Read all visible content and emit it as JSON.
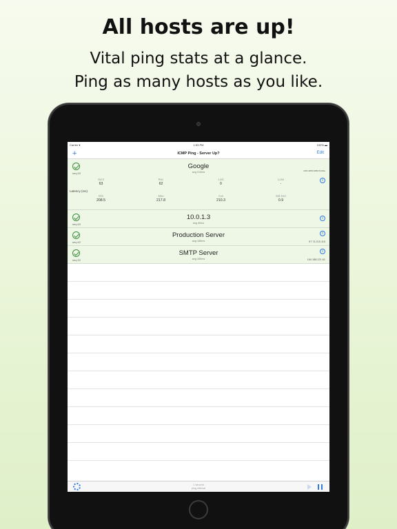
{
  "promo": {
    "headline": "All hosts are up!",
    "subline1": "Vital ping stats at a glance.",
    "subline2": "Ping as many hosts as you like."
  },
  "statusbar": {
    "carrier": "Carrier ▾",
    "time": "1:53 PM",
    "battery": "100% ▬"
  },
  "navbar": {
    "add": "+",
    "title": "ICMP Ping - Server Up?",
    "edit": "Edit"
  },
  "hosts": [
    {
      "name": "Google",
      "seq": "seq 63",
      "avg": "avg 210ms",
      "ip": "2001:4860:4860:8:200e",
      "stats_row1": [
        {
          "label": "Sent",
          "value": "63"
        },
        {
          "label": "Rec",
          "value": "62"
        },
        {
          "label": "Lost",
          "value": "0"
        },
        {
          "label": "Loss",
          "value": "-"
        }
      ],
      "latency_label": "Latency (ms)",
      "stats_row2": [
        {
          "label": "Min",
          "value": "208.5"
        },
        {
          "label": "Max",
          "value": "217.8"
        },
        {
          "label": "Ave",
          "value": "210.3"
        },
        {
          "label": "Std Dev",
          "value": "0.9"
        }
      ]
    },
    {
      "name": "10.0.1.3",
      "seq": "seq 63",
      "avg": "avg 40ms",
      "ip": ""
    },
    {
      "name": "Production Server",
      "seq": "seq 62",
      "avg": "avg 185ms",
      "ip": "97.74.215.115"
    },
    {
      "name": "SMTP Server",
      "seq": "seq 52",
      "avg": "avg 165ms",
      "ip": "164.188.221.61"
    }
  ],
  "toolbar": {
    "interval_line1": "1 second",
    "interval_line2": "ping interval"
  },
  "icons": {
    "check": "check-circle-icon",
    "info": "info-icon",
    "gear": "gear-icon",
    "play": "play-icon",
    "pause": "pause-icon",
    "add": "plus-icon"
  },
  "colors": {
    "accent": "#2a7ae2",
    "up": "#3a8d3a",
    "row_up": "#eef7e6"
  }
}
